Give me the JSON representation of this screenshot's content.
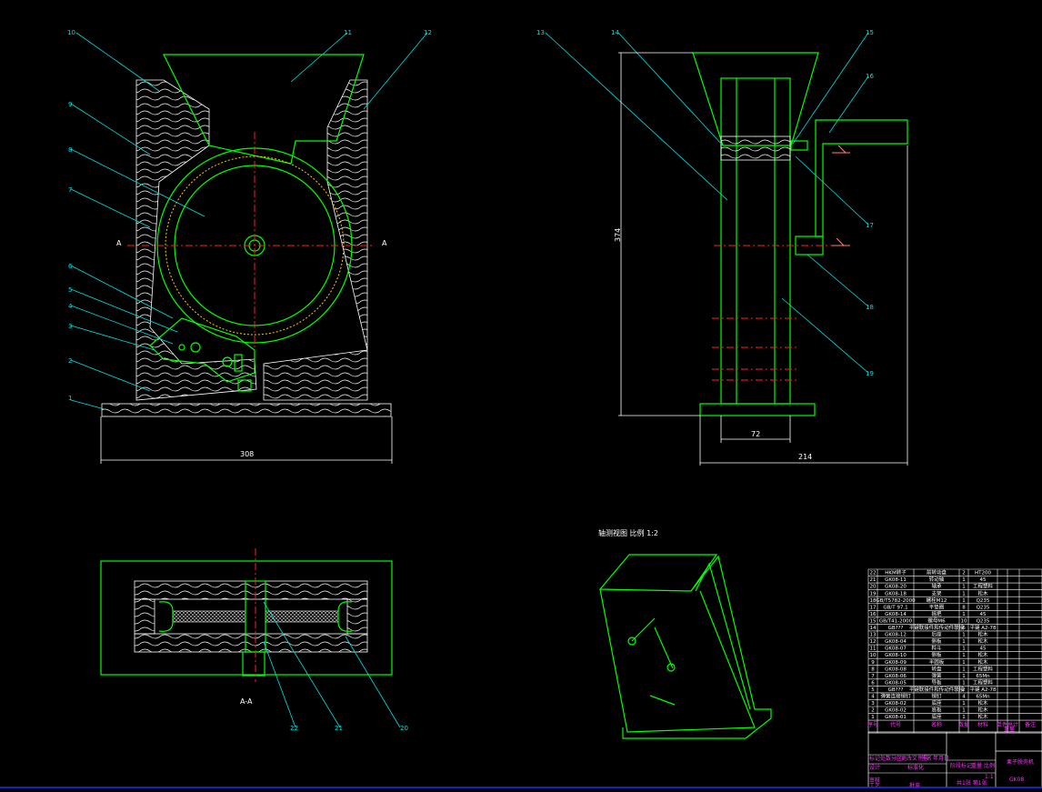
{
  "drawing": {
    "front_view": {
      "part_labels": [
        "10",
        "11",
        "12",
        "9",
        "8",
        "7",
        "6",
        "5",
        "4",
        "3",
        "2",
        "1"
      ],
      "section_marks": [
        "A",
        "A"
      ],
      "width_dimension": "308"
    },
    "side_view": {
      "part_labels": [
        "13",
        "14",
        "15",
        "16",
        "17",
        "18",
        "19"
      ],
      "height_dimension": "374",
      "inner_width_dimension": "72",
      "base_width_dimension": "214"
    },
    "section_view": {
      "title": "A-A",
      "part_labels": [
        "22",
        "21",
        "20"
      ]
    },
    "iso_view": {
      "title": "轴测视图   比例 1:2"
    }
  },
  "bom": {
    "rows": [
      {
        "no": "22",
        "code": "HKM转子",
        "name": "前转动盘",
        "qty": "2",
        "material": "HT200"
      },
      {
        "no": "21",
        "code": "GK08-11",
        "name": "转动轴",
        "qty": "1",
        "material": "45"
      },
      {
        "no": "20",
        "code": "GK08-20",
        "name": "轴承",
        "qty": "1",
        "material": "工程塑料"
      },
      {
        "no": "19",
        "code": "GK08-18",
        "name": "支架",
        "qty": "1",
        "material": "松木"
      },
      {
        "no": "18",
        "code": "GB/T5782-2000",
        "name": "螺栓M12",
        "qty": "1",
        "material": "Q235"
      },
      {
        "no": "17",
        "code": "GB/T 97.1",
        "name": "平垫圈",
        "qty": "8",
        "material": "Q235"
      },
      {
        "no": "16",
        "code": "GK08-14",
        "name": "摇把",
        "qty": "1",
        "material": "45"
      },
      {
        "no": "15",
        "code": "GB/T41-2000",
        "name": "螺母M6",
        "qty": "10",
        "material": "Q235"
      },
      {
        "no": "14",
        "code": "GB???",
        "name": "平键联接件和传动件联接",
        "qty": "6",
        "material": "平键 A2-78"
      },
      {
        "no": "13",
        "code": "GK08-12",
        "name": "后座",
        "qty": "1",
        "material": "松木"
      },
      {
        "no": "12",
        "code": "GK08-04",
        "name": "侧板",
        "qty": "1",
        "material": "松木"
      },
      {
        "no": "11",
        "code": "GK08-07",
        "name": "料斗",
        "qty": "1",
        "material": "45"
      },
      {
        "no": "10",
        "code": "GK08-10",
        "name": "侧板",
        "qty": "1",
        "material": "松木"
      },
      {
        "no": "9",
        "code": "GK08-09",
        "name": "半圆板",
        "qty": "1",
        "material": "松木"
      },
      {
        "no": "8",
        "code": "GK08-08",
        "name": "转盘",
        "qty": "1",
        "material": "工程塑料"
      },
      {
        "no": "7",
        "code": "GK08-06",
        "name": "弹簧",
        "qty": "1",
        "material": "65Mn"
      },
      {
        "no": "6",
        "code": "GK08-05",
        "name": "导板",
        "qty": "1",
        "material": "工程塑料"
      },
      {
        "no": "5",
        "code": "GB???",
        "name": "平键联接件和传动件联接",
        "qty": "2",
        "material": "平键 A2-78"
      },
      {
        "no": "4",
        "code": "弹簧连接销钉",
        "name": "销钉",
        "qty": "4",
        "material": "65Mn"
      },
      {
        "no": "3",
        "code": "GK08-02",
        "name": "底座",
        "qty": "1",
        "material": "松木"
      },
      {
        "no": "2",
        "code": "GK08-02",
        "name": "底板",
        "qty": "1",
        "material": "松木"
      },
      {
        "no": "1",
        "code": "GK08-01",
        "name": "底座",
        "qty": "1",
        "material": "松木"
      }
    ],
    "header": [
      "序号",
      "代号",
      "名称",
      "数量",
      "材料",
      "单件",
      "总计",
      "重量",
      "备注"
    ]
  },
  "title_block": {
    "labels": [
      "标记",
      "处数",
      "分区",
      "更改文件号",
      "签名",
      "年月日",
      "设计",
      "标准化",
      "审核",
      "工艺",
      "批准",
      "阶段标记",
      "重量",
      "比例"
    ],
    "scale": "1:1",
    "sheet": "共1张 第1张",
    "product_name": "栗子脱壳机",
    "drawing_no": "GK08"
  }
}
